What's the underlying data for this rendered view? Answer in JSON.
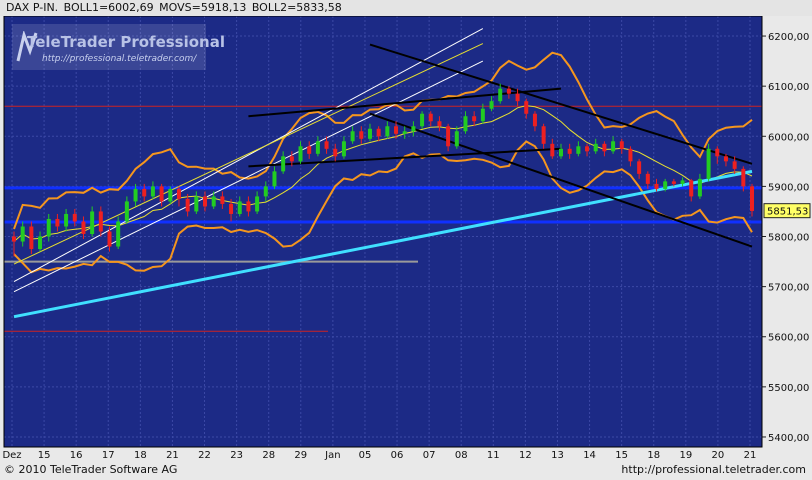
{
  "header": {
    "symbol": "DAX P-IN.",
    "boll1": "BOLL1=6002,69",
    "movs": "MOVS=5918,13",
    "boll2": "BOLL2=5833,58"
  },
  "logo": {
    "title": "TeleTrader Professional",
    "url": "http://professional.teletrader.com/"
  },
  "footer": {
    "copyright": "© 2010 TeleTrader Software AG",
    "url": "http://professional.teletrader.com"
  },
  "colors": {
    "background": "#1c2a86",
    "grid": "#3c49a6",
    "up_candle": "#22cc22",
    "down_candle": "#ee2020",
    "bollinger": "#f5961e",
    "moving_average": "#e8e030",
    "support_lines": "#1030ff",
    "trendline_cyan": "#40e0ff",
    "trendlines_black": "#000000"
  },
  "chart_data": {
    "type": "candlestick",
    "title": "DAX P-IN.",
    "ylim": [
      5380,
      6240
    ],
    "y_ticks": [
      "6200,00",
      "6100,00",
      "6000,00",
      "5900,00",
      "5800,00",
      "5700,00",
      "5600,00",
      "5500,00",
      "5400,00"
    ],
    "y_tick_values": [
      6200,
      6100,
      6000,
      5900,
      5800,
      5700,
      5600,
      5500,
      5400
    ],
    "x_labels": [
      "Dez",
      "15",
      "16",
      "17",
      "18",
      "21",
      "22",
      "23",
      "28",
      "29",
      "Jan",
      "05",
      "06",
      "07",
      "08",
      "11",
      "12",
      "13",
      "14",
      "15",
      "18",
      "19",
      "20",
      "21"
    ],
    "last_price": "5851,53",
    "last_price_value": 5851.53,
    "indicators": {
      "BOLL1": 6002.69,
      "MOVS": 5918.13,
      "BOLL2": 5833.58
    },
    "horizontal_levels": [
      {
        "name": "support-1",
        "value": 5897
      },
      {
        "name": "support-2",
        "value": 5829
      },
      {
        "name": "gray-level",
        "value": 5750
      },
      {
        "name": "red-level-top",
        "value": 6060
      },
      {
        "name": "red-level-bottom",
        "value": 5611
      }
    ],
    "candles": [
      [
        5800,
        5790,
        5760,
        5810
      ],
      [
        5790,
        5820,
        5780,
        5830
      ],
      [
        5820,
        5775,
        5765,
        5830
      ],
      [
        5775,
        5800,
        5770,
        5810
      ],
      [
        5800,
        5835,
        5790,
        5845
      ],
      [
        5835,
        5820,
        5810,
        5845
      ],
      [
        5820,
        5845,
        5810,
        5855
      ],
      [
        5845,
        5830,
        5820,
        5855
      ],
      [
        5830,
        5805,
        5795,
        5840
      ],
      [
        5805,
        5850,
        5800,
        5860
      ],
      [
        5850,
        5810,
        5800,
        5860
      ],
      [
        5810,
        5780,
        5770,
        5820
      ],
      [
        5780,
        5830,
        5775,
        5840
      ],
      [
        5830,
        5870,
        5825,
        5880
      ],
      [
        5870,
        5895,
        5860,
        5905
      ],
      [
        5895,
        5880,
        5870,
        5905
      ],
      [
        5880,
        5900,
        5875,
        5910
      ],
      [
        5900,
        5870,
        5860,
        5905
      ],
      [
        5870,
        5895,
        5865,
        5900
      ],
      [
        5895,
        5875,
        5860,
        5900
      ],
      [
        5875,
        5850,
        5840,
        5885
      ],
      [
        5850,
        5880,
        5845,
        5890
      ],
      [
        5880,
        5860,
        5850,
        5890
      ],
      [
        5860,
        5880,
        5855,
        5890
      ],
      [
        5880,
        5865,
        5855,
        5890
      ],
      [
        5865,
        5845,
        5830,
        5875
      ],
      [
        5845,
        5870,
        5840,
        5880
      ],
      [
        5870,
        5850,
        5840,
        5880
      ],
      [
        5850,
        5880,
        5845,
        5890
      ],
      [
        5880,
        5900,
        5870,
        5910
      ],
      [
        5900,
        5930,
        5895,
        5940
      ],
      [
        5930,
        5960,
        5925,
        5970
      ],
      [
        5960,
        5950,
        5940,
        5970
      ],
      [
        5950,
        5980,
        5945,
        5990
      ],
      [
        5980,
        5965,
        5955,
        5990
      ],
      [
        5965,
        5990,
        5960,
        6000
      ],
      [
        5990,
        5975,
        5965,
        6000
      ],
      [
        5975,
        5960,
        5950,
        5985
      ],
      [
        5960,
        5990,
        5955,
        6000
      ],
      [
        5990,
        6010,
        5985,
        6020
      ],
      [
        6010,
        5995,
        5985,
        6020
      ],
      [
        5995,
        6015,
        5990,
        6025
      ],
      [
        6015,
        6000,
        5990,
        6020
      ],
      [
        6000,
        6020,
        5995,
        6030
      ],
      [
        6020,
        6005,
        5995,
        6030
      ],
      [
        6005,
        6010,
        5995,
        6020
      ],
      [
        6010,
        6020,
        6000,
        6030
      ],
      [
        6020,
        6045,
        6015,
        6050
      ],
      [
        6045,
        6030,
        6020,
        6050
      ],
      [
        6030,
        6020,
        6010,
        6040
      ],
      [
        6020,
        5980,
        5970,
        6025
      ],
      [
        5980,
        6010,
        5975,
        6020
      ],
      [
        6010,
        6040,
        6005,
        6050
      ],
      [
        6040,
        6030,
        6020,
        6050
      ],
      [
        6030,
        6055,
        6025,
        6065
      ],
      [
        6055,
        6070,
        6050,
        6080
      ],
      [
        6070,
        6095,
        6065,
        6105
      ],
      [
        6095,
        6085,
        6075,
        6100
      ],
      [
        6085,
        6070,
        6060,
        6095
      ],
      [
        6070,
        6045,
        6035,
        6075
      ],
      [
        6045,
        6020,
        6010,
        6050
      ],
      [
        6020,
        5985,
        5975,
        6025
      ],
      [
        5985,
        5960,
        5955,
        5995
      ],
      [
        5960,
        5975,
        5955,
        5985
      ],
      [
        5975,
        5965,
        5955,
        5985
      ],
      [
        5965,
        5980,
        5960,
        5990
      ],
      [
        5980,
        5970,
        5960,
        5985
      ],
      [
        5970,
        5985,
        5965,
        5995
      ],
      [
        5985,
        5970,
        5960,
        5990
      ],
      [
        5970,
        5990,
        5965,
        6000
      ],
      [
        5990,
        5975,
        5965,
        5995
      ],
      [
        5975,
        5950,
        5940,
        5980
      ],
      [
        5950,
        5925,
        5915,
        5955
      ],
      [
        5925,
        5905,
        5895,
        5930
      ],
      [
        5905,
        5895,
        5890,
        5915
      ],
      [
        5895,
        5910,
        5890,
        5915
      ],
      [
        5910,
        5905,
        5900,
        5915
      ],
      [
        5905,
        5912,
        5900,
        5918
      ],
      [
        5912,
        5880,
        5870,
        5915
      ],
      [
        5880,
        5915,
        5875,
        5925
      ],
      [
        5915,
        5975,
        5910,
        5985
      ],
      [
        5975,
        5960,
        5945,
        5980
      ],
      [
        5960,
        5950,
        5940,
        5965
      ],
      [
        5950,
        5935,
        5925,
        5960
      ],
      [
        5935,
        5900,
        5890,
        5940
      ],
      [
        5900,
        5851,
        5840,
        5905
      ]
    ]
  }
}
